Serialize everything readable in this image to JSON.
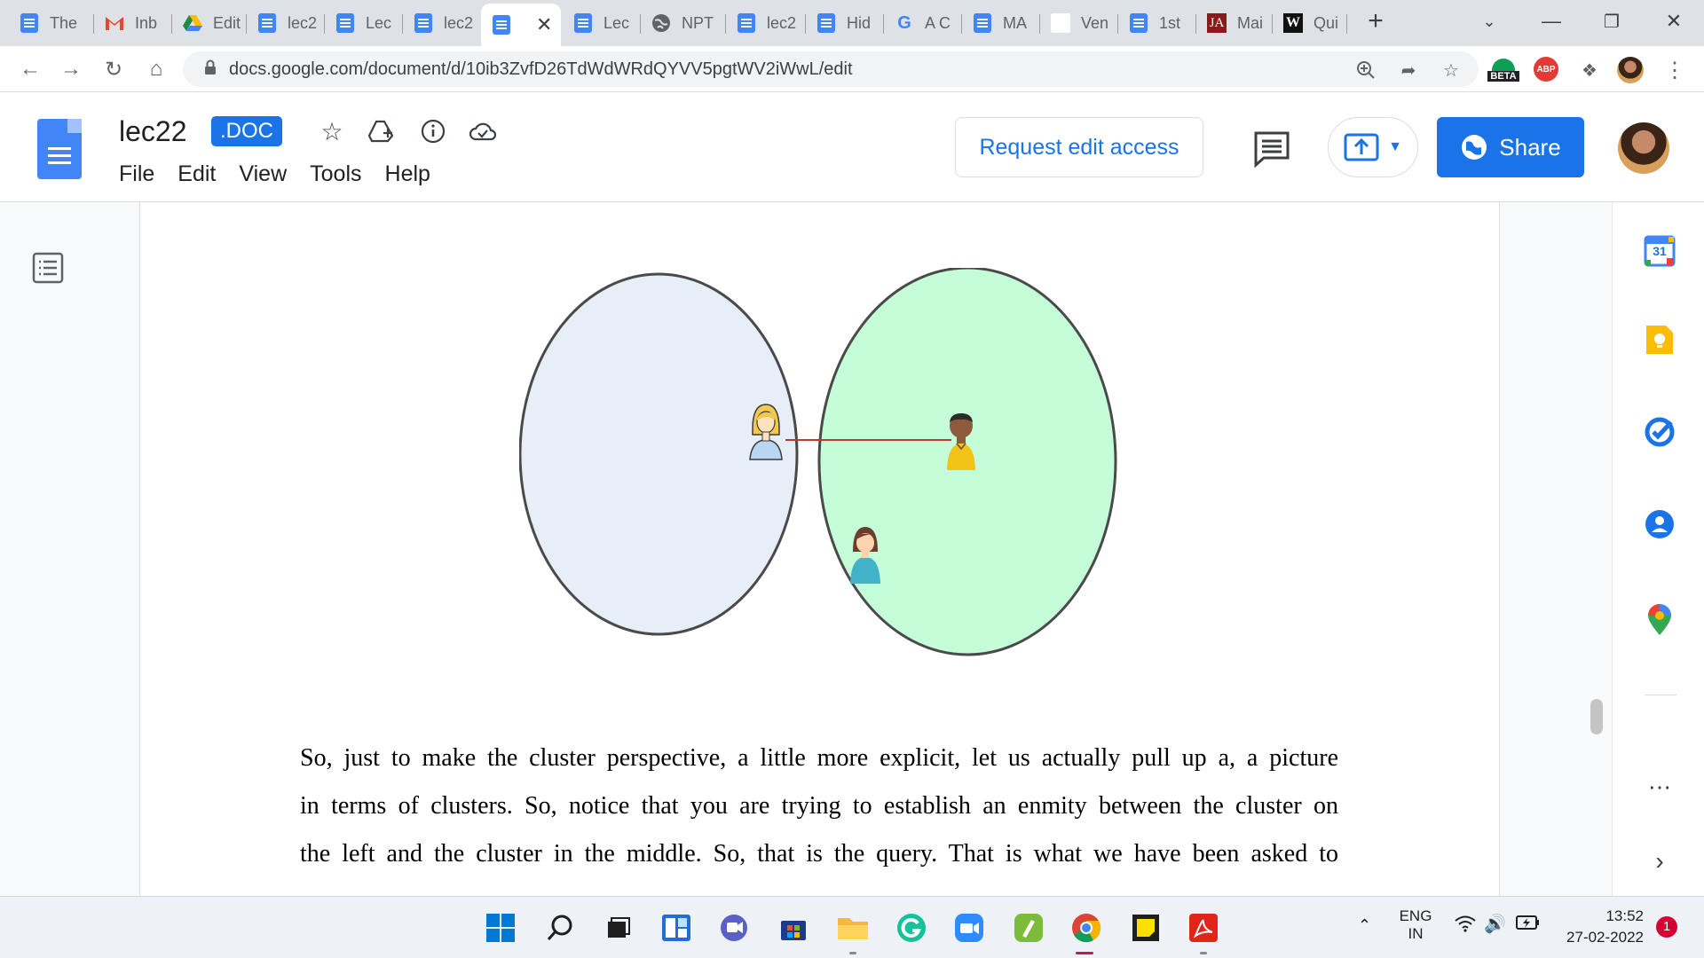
{
  "browser": {
    "tabs": [
      {
        "label": "The",
        "icon": "docs-icon"
      },
      {
        "label": "Inb",
        "icon": "gmail-icon"
      },
      {
        "label": "Edit",
        "icon": "drive-icon"
      },
      {
        "label": "lec2",
        "icon": "docs-icon"
      },
      {
        "label": "Lec",
        "icon": "docs-icon"
      },
      {
        "label": "lec2",
        "icon": "docs-icon"
      },
      {
        "label": "",
        "icon": "docs-icon",
        "active": true
      },
      {
        "label": "Lec",
        "icon": "docs-icon"
      },
      {
        "label": "NPT",
        "icon": "globe-icon"
      },
      {
        "label": "lec2",
        "icon": "docs-icon"
      },
      {
        "label": "Hid",
        "icon": "docs-icon"
      },
      {
        "label": "A C",
        "icon": "google-icon"
      },
      {
        "label": "MA",
        "icon": "docs-icon"
      },
      {
        "label": "Ven",
        "icon": "blank-page-icon"
      },
      {
        "label": "1st",
        "icon": "docs-icon"
      },
      {
        "label": "Mai",
        "icon": "ja-icon"
      },
      {
        "label": "Qui",
        "icon": "w-icon"
      }
    ],
    "url": "docs.google.com/document/d/10ib3ZvfD26TdWdWRdQYVV5pgtWV2iWwL/edit",
    "extension_badges": {
      "beta": "BETA",
      "abp": "ABP"
    }
  },
  "doc": {
    "title": "lec22",
    "badge": ".DOC",
    "menu": [
      "File",
      "Edit",
      "View",
      "Tools",
      "Help"
    ],
    "request_edit_label": "Request edit access",
    "share_label": "Share",
    "paragraph_lines": [
      "So, just to make the cluster perspective, a little more explicit, let us actually pull up a, a picture",
      "in terms of clusters. So, notice that you are trying to establish an enmity between the cluster on",
      "the left and the cluster in the middle. So, that is the query. That is what we have been asked to"
    ]
  },
  "diagram": {
    "left_cluster_fill": "#e6eff8",
    "right_cluster_fill": "#c4fdd7",
    "cluster_stroke": "#4a4a4a",
    "edge_color": "#c0392b",
    "nodes": [
      "woman-blonde-avatar-icon",
      "man-dark-avatar-icon",
      "girl-avatar-icon"
    ]
  },
  "side_panel": {
    "calendar_day": "31",
    "apps": [
      "calendar-icon",
      "keep-icon",
      "tasks-icon",
      "contacts-icon",
      "maps-icon"
    ]
  },
  "taskbar": {
    "language_top": "ENG",
    "language_bottom": "IN",
    "time": "13:52",
    "date": "27-02-2022",
    "notification_count": "1"
  },
  "colors": {
    "accent": "#1a73e8",
    "docs_blue": "#4285f4"
  }
}
